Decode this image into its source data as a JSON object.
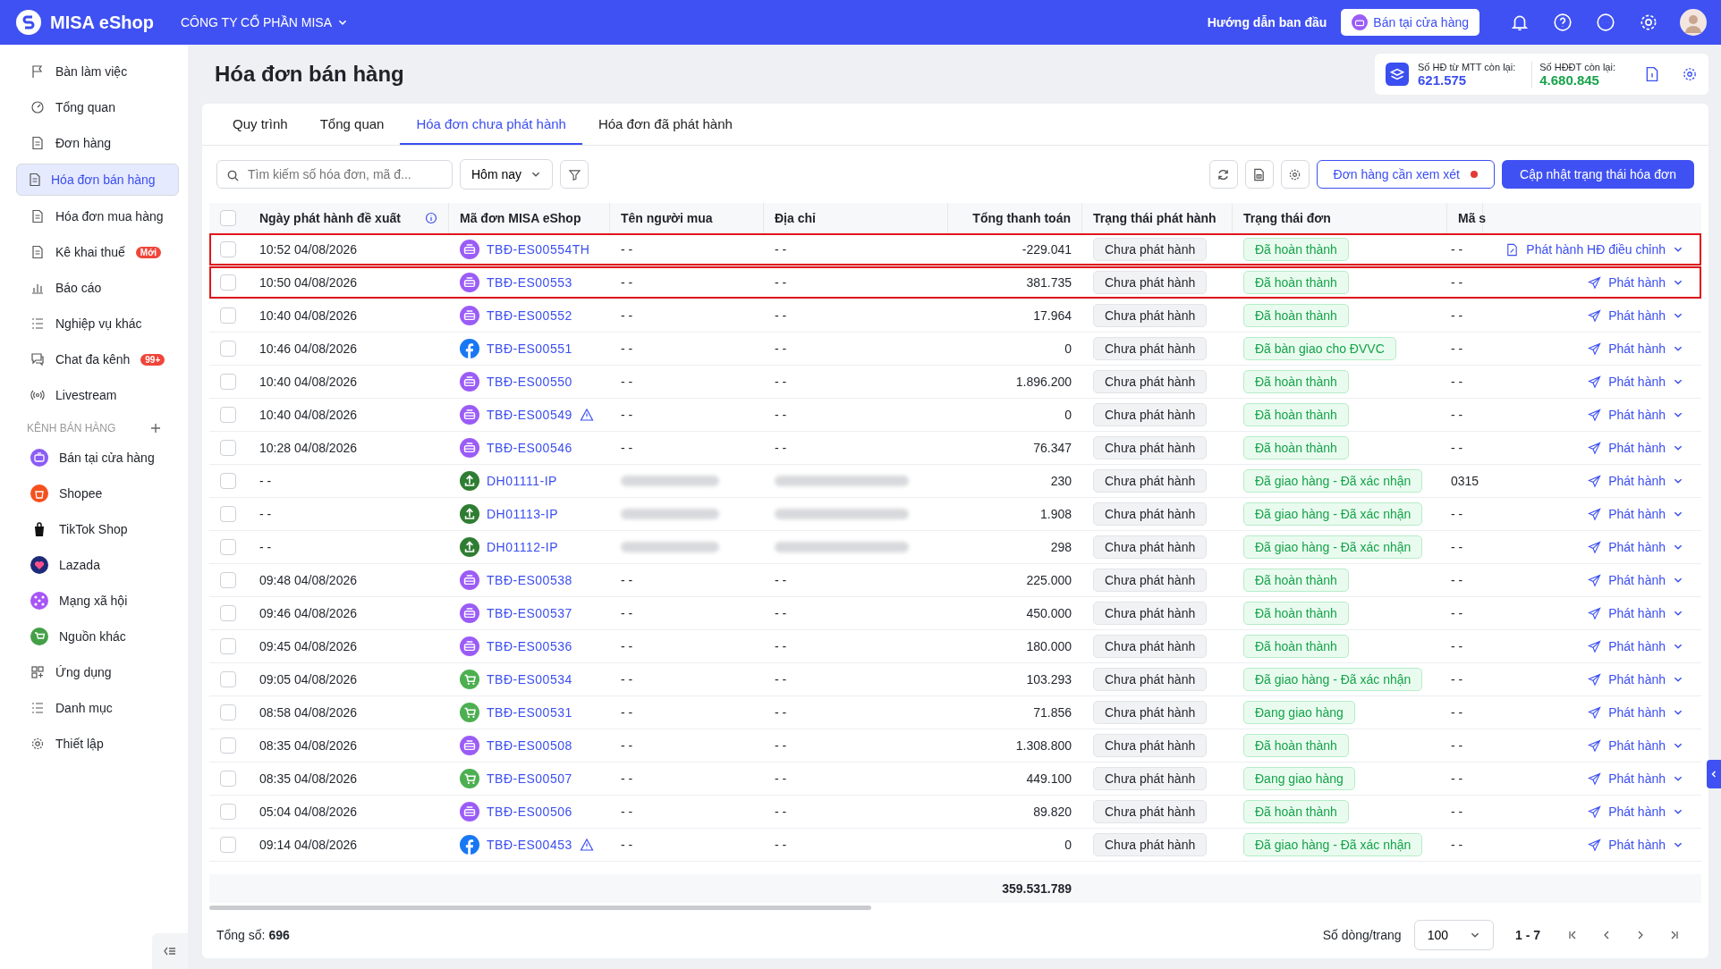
{
  "topbar": {
    "brand": "MISA eShop",
    "company": "CÔNG TY CỔ PHẦN MISA",
    "guide_link": "Hướng dẫn ban đầu",
    "store_button": "Bán tại cửa hàng"
  },
  "sidebar": {
    "items": [
      {
        "label": "Bàn làm việc",
        "selected": false
      },
      {
        "label": "Tổng quan",
        "selected": false
      },
      {
        "label": "Đơn hàng",
        "selected": false
      },
      {
        "label": "Hóa đơn bán hàng",
        "selected": true
      },
      {
        "label": "Hóa đơn mua hàng",
        "selected": false
      },
      {
        "label": "Kê khai thuế",
        "selected": false,
        "badge": "Mới"
      },
      {
        "label": "Báo cáo",
        "selected": false
      },
      {
        "label": "Nghiệp vụ khác",
        "selected": false
      },
      {
        "label": "Chat đa kênh",
        "selected": false,
        "badge": "99+"
      },
      {
        "label": "Livestream",
        "selected": false
      }
    ],
    "section_title": "KÊNH BÁN HÀNG",
    "channels": [
      {
        "label": "Bán tại cửa hàng",
        "color": "#8b5cf6"
      },
      {
        "label": "Shopee",
        "color": "#f4511e"
      },
      {
        "label": "TikTok Shop",
        "color": "#111111"
      },
      {
        "label": "Lazada",
        "color": "#1e2a78"
      },
      {
        "label": "Mạng xã hội",
        "color": "#a855f7"
      },
      {
        "label": "Nguồn khác",
        "color": "#43a047"
      }
    ],
    "bottom_items": [
      {
        "label": "Ứng dụng"
      },
      {
        "label": "Danh mục"
      },
      {
        "label": "Thiết lập"
      }
    ]
  },
  "page": {
    "title": "Hóa đơn bán hàng",
    "counters": [
      {
        "label": "Số HĐ từ MTT còn lại:",
        "value": "621.575",
        "color": "#3b4ef0"
      },
      {
        "label": "Số HĐĐT còn lại:",
        "value": "4.680.845",
        "color": "#16a34a"
      }
    ]
  },
  "tabs": [
    {
      "label": "Quy trình",
      "selected": false
    },
    {
      "label": "Tổng quan",
      "selected": false
    },
    {
      "label": "Hóa đơn chưa phát hành",
      "selected": true
    },
    {
      "label": "Hóa đơn đã phát hành",
      "selected": false
    }
  ],
  "toolbar": {
    "search_placeholder": "Tìm kiếm số hóa đơn, mã đ...",
    "period": "Hôm nay",
    "review_button": "Đơn hàng cần xem xét",
    "update_button": "Cập nhật trạng thái hóa đơn"
  },
  "table": {
    "select_all_checked": false,
    "columns": [
      "Ngày phát hành đề xuất",
      "Mã đơn MISA eShop",
      "Tên người mua",
      "Địa chỉ",
      "Tổng thanh toán",
      "Trạng thái phát hành",
      "Trạng thái đơn",
      "Mã s"
    ],
    "rows": [
      {
        "date": "10:52 04/08/2026",
        "kind": "store",
        "code": "TBĐ-ES00554TH",
        "warning": false,
        "checked": false,
        "redacted": false,
        "buyer": "- -",
        "address": "- -",
        "total": "-229.041",
        "issue_status": "Chưa phát hành",
        "order_status": "Đã hoàn thành",
        "col8": "- -",
        "action": {
          "kind": "adjust",
          "label": "Phát hành HĐ điều chỉnh"
        },
        "highlighted": true
      },
      {
        "date": "10:50 04/08/2026",
        "kind": "store",
        "code": "TBĐ-ES00553",
        "warning": false,
        "checked": false,
        "redacted": false,
        "buyer": "- -",
        "address": "- -",
        "total": "381.735",
        "issue_status": "Chưa phát hành",
        "order_status": "Đã hoàn thành",
        "col8": "- -",
        "action": {
          "kind": "send",
          "label": "Phát hành"
        },
        "highlighted": true
      },
      {
        "date": "10:40 04/08/2026",
        "kind": "store",
        "code": "TBĐ-ES00552",
        "warning": false,
        "checked": false,
        "redacted": false,
        "buyer": "- -",
        "address": "- -",
        "total": "17.964",
        "issue_status": "Chưa phát hành",
        "order_status": "Đã hoàn thành",
        "col8": "- -",
        "action": {
          "kind": "send",
          "label": "Phát hành"
        },
        "highlighted": false
      },
      {
        "date": "10:46 04/08/2026",
        "kind": "facebook",
        "code": "TBĐ-ES00551",
        "warning": false,
        "checked": false,
        "redacted": false,
        "buyer": "- -",
        "address": "- -",
        "total": "0",
        "issue_status": "Chưa phát hành",
        "order_status": "Đã bàn giao cho ĐVVC",
        "col8": "- -",
        "action": {
          "kind": "send",
          "label": "Phát hành"
        },
        "highlighted": false
      },
      {
        "date": "10:40 04/08/2026",
        "kind": "store",
        "code": "TBĐ-ES00550",
        "warning": false,
        "checked": false,
        "redacted": false,
        "buyer": "- -",
        "address": "- -",
        "total": "1.896.200",
        "issue_status": "Chưa phát hành",
        "order_status": "Đã hoàn thành",
        "col8": "- -",
        "action": {
          "kind": "send",
          "label": "Phát hành"
        },
        "highlighted": false
      },
      {
        "date": "10:40 04/08/2026",
        "kind": "store",
        "code": "TBĐ-ES00549",
        "warning": true,
        "checked": false,
        "redacted": false,
        "buyer": "- -",
        "address": "- -",
        "total": "0",
        "issue_status": "Chưa phát hành",
        "order_status": "Đã hoàn thành",
        "col8": "- -",
        "action": {
          "kind": "send",
          "label": "Phát hành"
        },
        "highlighted": false
      },
      {
        "date": "10:28 04/08/2026",
        "kind": "store",
        "code": "TBĐ-ES00546",
        "warning": false,
        "checked": false,
        "redacted": false,
        "buyer": "- -",
        "address": "- -",
        "total": "76.347",
        "issue_status": "Chưa phát hành",
        "order_status": "Đã hoàn thành",
        "col8": "- -",
        "action": {
          "kind": "send",
          "label": "Phát hành"
        },
        "highlighted": false
      },
      {
        "date": "- -",
        "kind": "upload",
        "code": "DH01111-IP",
        "warning": false,
        "checked": false,
        "redacted": true,
        "total": "230",
        "issue_status": "Chưa phát hành",
        "order_status": "Đã giao hàng - Đã xác nhận",
        "col8": "0315",
        "action": {
          "kind": "send",
          "label": "Phát hành"
        },
        "highlighted": false
      },
      {
        "date": "- -",
        "kind": "upload",
        "code": "DH01113-IP",
        "warning": false,
        "checked": false,
        "redacted": true,
        "total": "1.908",
        "issue_status": "Chưa phát hành",
        "order_status": "Đã giao hàng - Đã xác nhận",
        "col8": "- -",
        "action": {
          "kind": "send",
          "label": "Phát hành"
        },
        "highlighted": false
      },
      {
        "date": "- -",
        "kind": "upload",
        "code": "DH01112-IP",
        "warning": false,
        "checked": false,
        "redacted": true,
        "total": "298",
        "issue_status": "Chưa phát hành",
        "order_status": "Đã giao hàng - Đã xác nhận",
        "col8": "- -",
        "action": {
          "kind": "send",
          "label": "Phát hành"
        },
        "highlighted": false
      },
      {
        "date": "09:48 04/08/2026",
        "kind": "store",
        "code": "TBĐ-ES00538",
        "warning": false,
        "checked": false,
        "redacted": false,
        "buyer": "- -",
        "address": "- -",
        "total": "225.000",
        "issue_status": "Chưa phát hành",
        "order_status": "Đã hoàn thành",
        "col8": "- -",
        "action": {
          "kind": "send",
          "label": "Phát hành"
        },
        "highlighted": false
      },
      {
        "date": "09:46 04/08/2026",
        "kind": "store",
        "code": "TBĐ-ES00537",
        "warning": false,
        "checked": false,
        "redacted": false,
        "buyer": "- -",
        "address": "- -",
        "total": "450.000",
        "issue_status": "Chưa phát hành",
        "order_status": "Đã hoàn thành",
        "col8": "- -",
        "action": {
          "kind": "send",
          "label": "Phát hành"
        },
        "highlighted": false
      },
      {
        "date": "09:45 04/08/2026",
        "kind": "store",
        "code": "TBĐ-ES00536",
        "warning": false,
        "checked": false,
        "redacted": false,
        "buyer": "- -",
        "address": "- -",
        "total": "180.000",
        "issue_status": "Chưa phát hành",
        "order_status": "Đã hoàn thành",
        "col8": "- -",
        "action": {
          "kind": "send",
          "label": "Phát hành"
        },
        "highlighted": false
      },
      {
        "date": "09:05 04/08/2026",
        "kind": "cart",
        "code": "TBĐ-ES00534",
        "warning": false,
        "checked": false,
        "redacted": false,
        "buyer": "- -",
        "address": "- -",
        "total": "103.293",
        "issue_status": "Chưa phát hành",
        "order_status": "Đã giao hàng - Đã xác nhận",
        "col8": "- -",
        "action": {
          "kind": "send",
          "label": "Phát hành"
        },
        "highlighted": false
      },
      {
        "date": "08:58 04/08/2026",
        "kind": "cart",
        "code": "TBĐ-ES00531",
        "warning": false,
        "checked": false,
        "redacted": false,
        "buyer": "- -",
        "address": "- -",
        "total": "71.856",
        "issue_status": "Chưa phát hành",
        "order_status": "Đang giao hàng",
        "col8": "- -",
        "action": {
          "kind": "send",
          "label": "Phát hành"
        },
        "highlighted": false
      },
      {
        "date": "08:35 04/08/2026",
        "kind": "store",
        "code": "TBĐ-ES00508",
        "warning": false,
        "checked": false,
        "redacted": false,
        "buyer": "- -",
        "address": "- -",
        "total": "1.308.800",
        "issue_status": "Chưa phát hành",
        "order_status": "Đã hoàn thành",
        "col8": "- -",
        "action": {
          "kind": "send",
          "label": "Phát hành"
        },
        "highlighted": false
      },
      {
        "date": "08:35 04/08/2026",
        "kind": "cart",
        "code": "TBĐ-ES00507",
        "warning": false,
        "checked": false,
        "redacted": false,
        "buyer": "- -",
        "address": "- -",
        "total": "449.100",
        "issue_status": "Chưa phát hành",
        "order_status": "Đang giao hàng",
        "col8": "- -",
        "action": {
          "kind": "send",
          "label": "Phát hành"
        },
        "highlighted": false
      },
      {
        "date": "05:04 04/08/2026",
        "kind": "store",
        "code": "TBĐ-ES00506",
        "warning": false,
        "checked": false,
        "redacted": false,
        "buyer": "- -",
        "address": "- -",
        "total": "89.820",
        "issue_status": "Chưa phát hành",
        "order_status": "Đã hoàn thành",
        "col8": "- -",
        "action": {
          "kind": "send",
          "label": "Phát hành"
        },
        "highlighted": false
      },
      {
        "date": "09:14 04/08/2026",
        "kind": "facebook",
        "code": "TBĐ-ES00453",
        "warning": true,
        "checked": false,
        "redacted": false,
        "buyer": "- -",
        "address": "- -",
        "total": "0",
        "issue_status": "Chưa phát hành",
        "order_status": "Đã giao hàng - Đã xác nhận",
        "col8": "- -",
        "action": {
          "kind": "send",
          "label": "Phát hành"
        },
        "highlighted": false
      }
    ],
    "sum_total": "359.531.789"
  },
  "footer": {
    "total_label": "Tổng số:",
    "total_value": "696",
    "page_size_label": "Số dòng/trang",
    "page_size": "100",
    "range": "1 - 7"
  }
}
